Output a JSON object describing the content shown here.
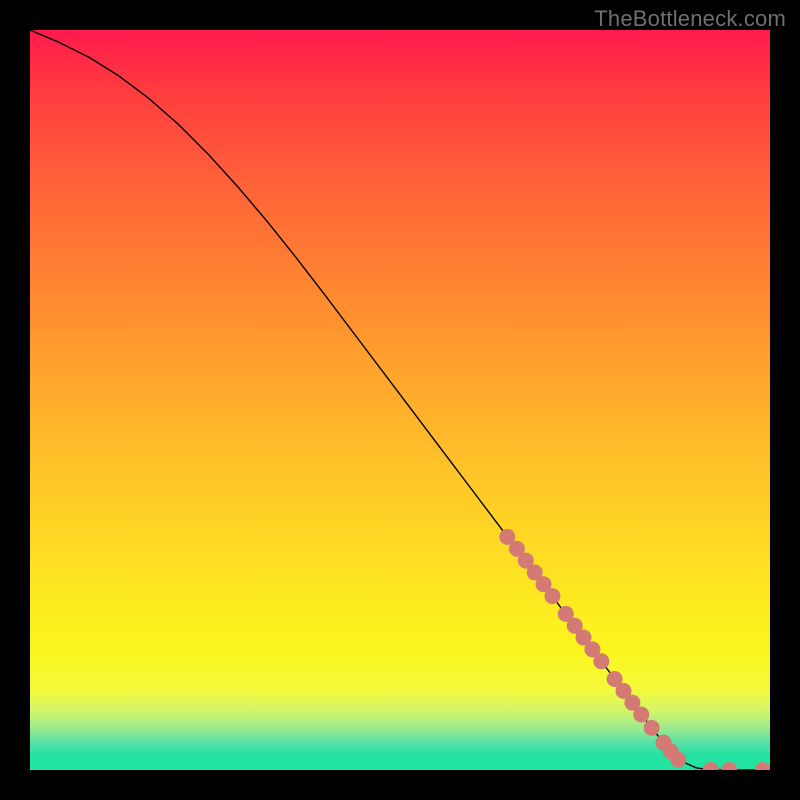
{
  "watermark": "TheBottleneck.com",
  "chart_data": {
    "type": "line",
    "title": "",
    "xlabel": "",
    "ylabel": "",
    "xlim": [
      0,
      100
    ],
    "ylim": [
      0,
      100
    ],
    "grid": false,
    "series": [
      {
        "name": "curve",
        "color": "#000000",
        "stroke_width": 1.4,
        "x": [
          0,
          4,
          8,
          12,
          16,
          20,
          24,
          28,
          32,
          36,
          40,
          44,
          48,
          52,
          56,
          60,
          64,
          68,
          72,
          76,
          80,
          84,
          86,
          88,
          90,
          92,
          94,
          96,
          98,
          100
        ],
        "y": [
          100,
          98.3,
          96.3,
          93.8,
          90.8,
          87.3,
          83.3,
          78.9,
          74.2,
          69.2,
          64.0,
          58.7,
          53.4,
          48.1,
          42.8,
          37.5,
          32.2,
          26.9,
          21.6,
          16.3,
          11.0,
          5.7,
          3.2,
          1.2,
          0.3,
          0.0,
          0.0,
          0.0,
          0.0,
          0.0
        ]
      },
      {
        "name": "highlight-dots",
        "type": "scatter",
        "color": "#d47a74",
        "radius": 8,
        "x": [
          64.5,
          65.8,
          67.0,
          68.2,
          69.4,
          70.6,
          72.4,
          73.6,
          74.8,
          76.0,
          77.2,
          79.0,
          80.2,
          81.4,
          82.6,
          84.0,
          85.6,
          86.6,
          87.6,
          92.0,
          94.5,
          99.0
        ],
        "y": [
          31.5,
          29.9,
          28.3,
          26.7,
          25.1,
          23.5,
          21.1,
          19.5,
          17.9,
          16.3,
          14.7,
          12.3,
          10.7,
          9.1,
          7.5,
          5.7,
          3.7,
          2.5,
          1.4,
          0.0,
          0.0,
          0.0
        ]
      }
    ]
  }
}
